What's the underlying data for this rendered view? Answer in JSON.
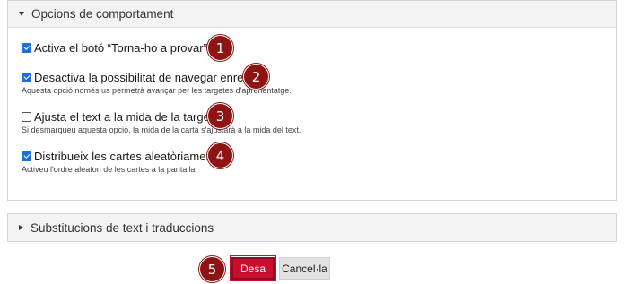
{
  "behaviour": {
    "title": "Opcions de comportament",
    "options": [
      {
        "label": "Activa el botó “Torna-ho a provar”",
        "desc": "",
        "checked": true,
        "step": "1"
      },
      {
        "label": "Desactiva la possibilitat de navegar enrere",
        "desc": "Aquesta opció només us permetrà avançar per les targetes d'aprenentatge.",
        "checked": true,
        "step": "2"
      },
      {
        "label": "Ajusta el text a la mida de la targeta",
        "desc": "Si desmarqueu aquesta opció, la mida de la carta s'ajustarà a la mida del text.",
        "checked": false,
        "step": "3"
      },
      {
        "label": "Distribueix les cartes aleatòriament",
        "desc": "Activeu l'ordre aleatori de les cartes a la pantalla.",
        "checked": true,
        "step": "4"
      }
    ]
  },
  "texts": {
    "title": "Substitucions de text i traduccions"
  },
  "actions": {
    "save_label": "Desa",
    "cancel_label": "Cancel·la",
    "step": "5"
  },
  "colors": {
    "badge": "#8e1414",
    "save_button": "#c8102e",
    "checkbox": "#1c6fd6"
  }
}
